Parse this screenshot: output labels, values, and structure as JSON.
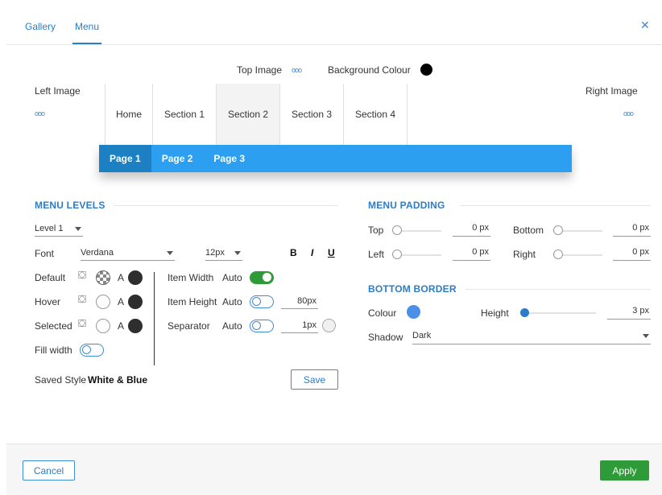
{
  "tabs": [
    "Gallery",
    "Menu"
  ],
  "active_tab": "Menu",
  "preview": {
    "top_image_label": "Top Image",
    "background_colour_label": "Background Colour",
    "background_colour": "#000000",
    "left_image_label": "Left Image",
    "right_image_label": "Right Image",
    "more_glyph": "ooo",
    "menu_items": [
      "Home",
      "Section 1",
      "Section 2",
      "Section 3",
      "Section 4"
    ],
    "selected_menu_item": "Section 2",
    "submenu_items": [
      "Page 1",
      "Page 2",
      "Page 3"
    ],
    "selected_submenu_item": "Page 1",
    "submenu_color": "#2d9ff0"
  },
  "menu_levels": {
    "title": "MENU LEVELS",
    "level": "Level 1",
    "font_label": "Font",
    "font_value": "Verdana",
    "font_size": "12px",
    "bold": "B",
    "italic": "I",
    "underline": "U",
    "states": [
      "Default",
      "Hover",
      "Selected"
    ],
    "text_mark": "A",
    "fill_width_label": "Fill width",
    "item_width_label": "Item Width",
    "item_width_auto": "Auto",
    "item_height_label": "Item Height",
    "item_height_auto": "Auto",
    "item_height_value": "80px",
    "separator_label": "Separator",
    "separator_auto": "Auto",
    "separator_value": "1px",
    "saved_style_label": "Saved Style",
    "saved_style_value": "White & Blue",
    "save_button": "Save"
  },
  "menu_padding": {
    "title": "MENU PADDING",
    "top_label": "Top",
    "top_value": "0",
    "bottom_label": "Bottom",
    "bottom_value": "0",
    "left_label": "Left",
    "left_value": "0",
    "right_label": "Right",
    "right_value": "0",
    "unit": "px"
  },
  "bottom_border": {
    "title": "BOTTOM BORDER",
    "colour_label": "Colour",
    "colour": "#4a90e8",
    "height_label": "Height",
    "height_value": "3",
    "unit": "px",
    "shadow_label": "Shadow",
    "shadow_value": "Dark"
  },
  "footer": {
    "cancel": "Cancel",
    "apply": "Apply",
    "apply_color": "#2e9b38"
  }
}
